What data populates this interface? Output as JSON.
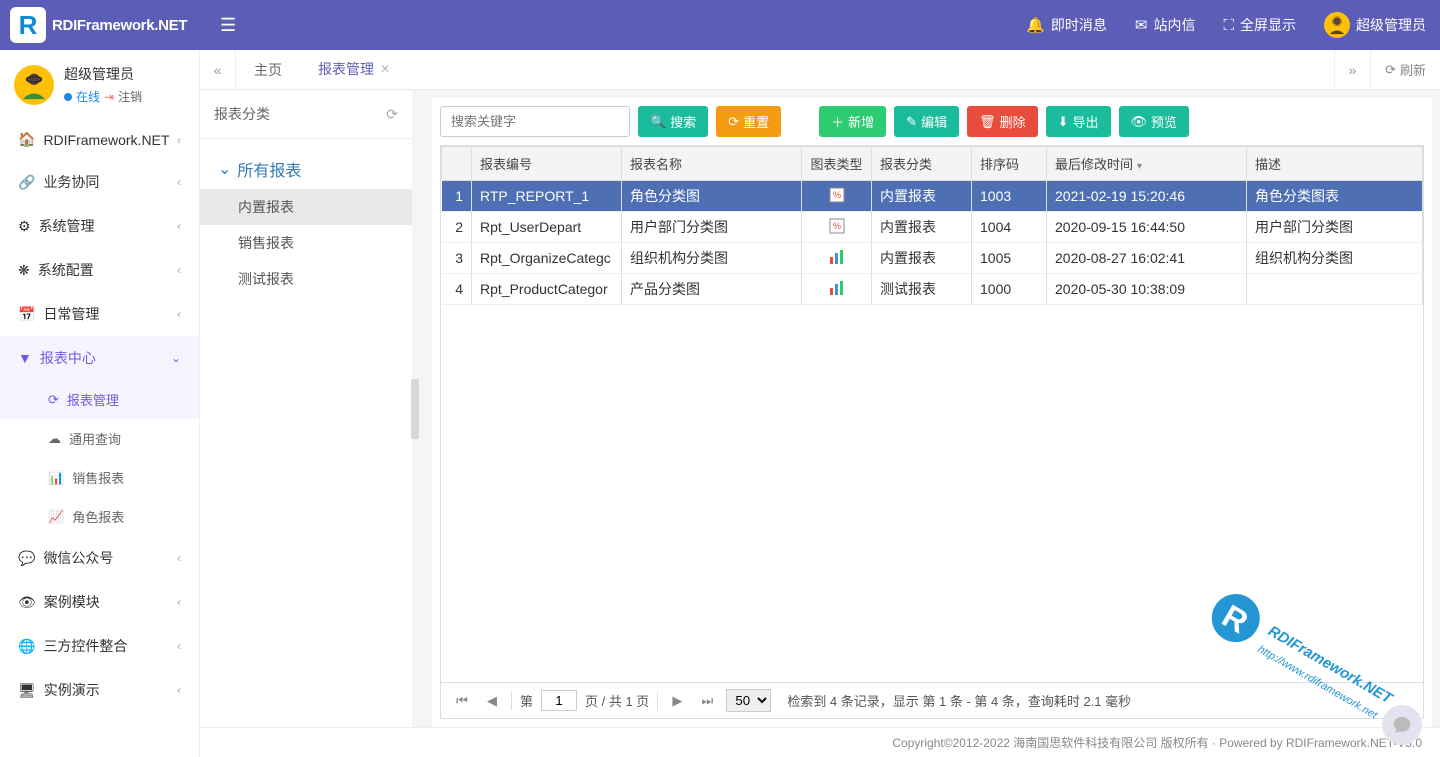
{
  "brand": {
    "logo_letter": "R",
    "name": "RDIFramework.NET"
  },
  "header": {
    "instant_msg": "即时消息",
    "inbox": "站内信",
    "fullscreen": "全屏显示",
    "username": "超级管理员"
  },
  "user_panel": {
    "name": "超级管理员",
    "status": "在线",
    "logout": "注销"
  },
  "sidebar": {
    "items": [
      {
        "icon": "🏠",
        "label": "RDIFramework.NET"
      },
      {
        "icon": "🔗",
        "label": "业务协同"
      },
      {
        "icon": "⚙",
        "label": "系统管理"
      },
      {
        "icon": "❋",
        "label": "系统配置"
      },
      {
        "icon": "📅",
        "label": "日常管理"
      },
      {
        "icon": "▼",
        "label": "报表中心",
        "active": true
      },
      {
        "icon": "💬",
        "label": "微信公众号"
      },
      {
        "icon": "👁",
        "label": "案例模块"
      },
      {
        "icon": "🌐",
        "label": "三方控件整合"
      },
      {
        "icon": "🖥",
        "label": "实例演示"
      }
    ],
    "report_sub": [
      {
        "icon": "⟳",
        "label": "报表管理",
        "active": true
      },
      {
        "icon": "☁",
        "label": "通用查询"
      },
      {
        "icon": "📊",
        "label": "销售报表"
      },
      {
        "icon": "📈",
        "label": "角色报表"
      }
    ]
  },
  "tabs": {
    "home": "主页",
    "report_mgmt": "报表管理",
    "refresh": "刷新"
  },
  "tree": {
    "title": "报表分类",
    "root": "所有报表",
    "children": [
      "内置报表",
      "销售报表",
      "测试报表"
    ]
  },
  "toolbar": {
    "search_placeholder": "搜索关键字",
    "search": "搜索",
    "reset": "重置",
    "add": "新增",
    "edit": "编辑",
    "delete": "删除",
    "export": "导出",
    "preview": "预览"
  },
  "grid": {
    "headers": [
      "",
      "报表编号",
      "报表名称",
      "图表类型",
      "报表分类",
      "排序码",
      "最后修改时间",
      "描述"
    ],
    "rows": [
      {
        "n": "1",
        "code": "RTP_REPORT_1",
        "name": "角色分类图",
        "type": "percent",
        "cat": "内置报表",
        "sort": "1003",
        "time": "2021-02-19 15:20:46",
        "desc": "角色分类图表",
        "sel": true
      },
      {
        "n": "2",
        "code": "Rpt_UserDepart",
        "name": "用户部门分类图",
        "type": "percent",
        "cat": "内置报表",
        "sort": "1004",
        "time": "2020-09-15 16:44:50",
        "desc": "用户部门分类图"
      },
      {
        "n": "3",
        "code": "Rpt_OrganizeCategc",
        "name": "组织机构分类图",
        "type": "bar",
        "cat": "内置报表",
        "sort": "1005",
        "time": "2020-08-27 16:02:41",
        "desc": "组织机构分类图"
      },
      {
        "n": "4",
        "code": "Rpt_ProductCategor",
        "name": "产品分类图",
        "type": "bar",
        "cat": "测试报表",
        "sort": "1000",
        "time": "2020-05-30 10:38:09",
        "desc": ""
      }
    ]
  },
  "pager": {
    "page_label_pre": "第",
    "page_value": "1",
    "page_label_post": "页 / 共 1 页",
    "page_size": "50",
    "info": "检索到 4 条记录，显示 第 1 条 - 第 4 条，查询耗时 2.1 毫秒"
  },
  "footer": {
    "text": "Copyright©2012-2022 海南国思软件科技有限公司 版权所有 · Powered by RDIFramework.NET-V5.0"
  }
}
